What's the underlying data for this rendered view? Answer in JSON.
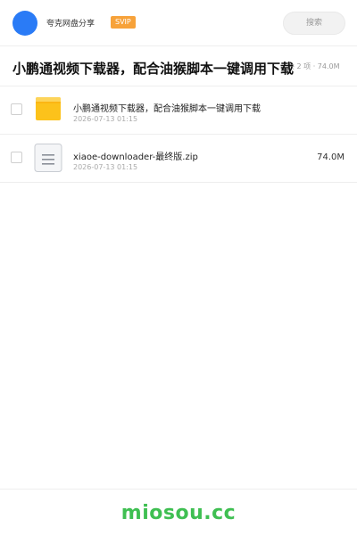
{
  "header": {
    "brand": "夸克网盘分享",
    "badge": "SVIP",
    "search_placeholder": "搜索"
  },
  "folder": {
    "title": "小鹏通视频下载器，配合油猴脚本一键调用下载",
    "summary": "共 2 项 · 74.0M"
  },
  "files": [
    {
      "icon": "folder-icon",
      "name": "小鹏通视频下载器，配合油猴脚本一键调用下载",
      "time": "2026-07-13 01:15",
      "size": ""
    },
    {
      "icon": "zip-file-icon",
      "name": "xiaoe-downloader-最终版.zip",
      "time": "2026-07-13 01:15",
      "size": "74.0M"
    }
  ],
  "footer": {
    "watermark": "miosou.cc"
  },
  "colors": {
    "accent_blue": "#2a7bf6",
    "svip_orange": "#f7a23a",
    "folder_yellow": "#fcc21b",
    "watermark_green": "#3fbf52"
  }
}
